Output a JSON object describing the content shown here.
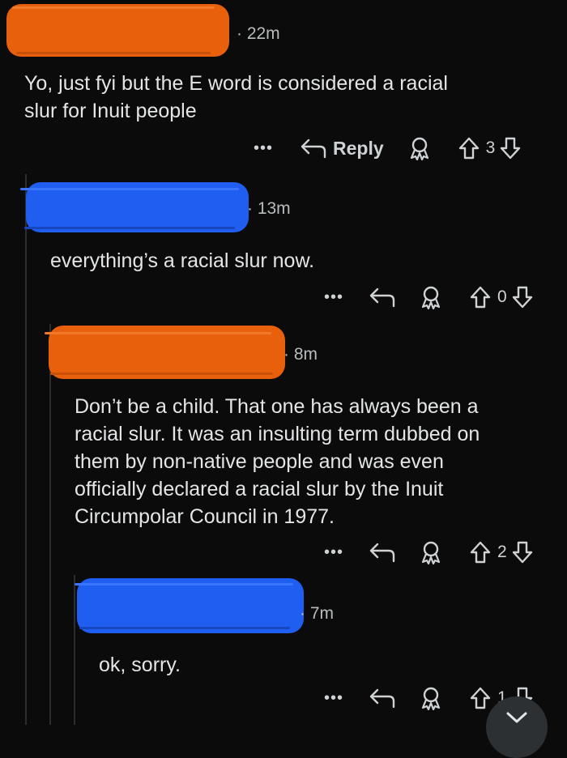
{
  "comments": [
    {
      "author": "",
      "time": "22m",
      "text_lines": [
        "Yo, just fyi but the E word is considered a racial",
        "slur for Inuit people"
      ],
      "more": "•••",
      "reply_label": "Reply",
      "votes": "3"
    },
    {
      "author": "",
      "time": "13m",
      "text_lines": [
        "everything’s a racial slur now."
      ],
      "more": "•••",
      "votes": "0"
    },
    {
      "author": "",
      "time": "8m",
      "text_lines": [
        "Don’t be a child. That one has always been a",
        "racial slur. It was an insulting term dubbed on",
        "them by non-native people and was even",
        "officially declared a racial slur by the Inuit",
        "Circumpolar Council in 1977."
      ],
      "more": "•••",
      "votes": "2"
    },
    {
      "author": "",
      "time": "7m",
      "text_lines": [
        "ok, sorry."
      ],
      "more": "•••",
      "votes": "1"
    }
  ],
  "colors": {
    "redact_orange": "#e8600c",
    "redact_blue": "#1f5ef0",
    "background": "#0b0b0b",
    "text": "#e3e5e7"
  },
  "icons": {
    "more": "ellipsis-icon",
    "reply": "reply-arrow-icon",
    "award": "award-icon",
    "upvote": "upvote-arrow-icon",
    "downvote": "downvote-arrow-icon",
    "fab": "chevron-down-icon"
  }
}
